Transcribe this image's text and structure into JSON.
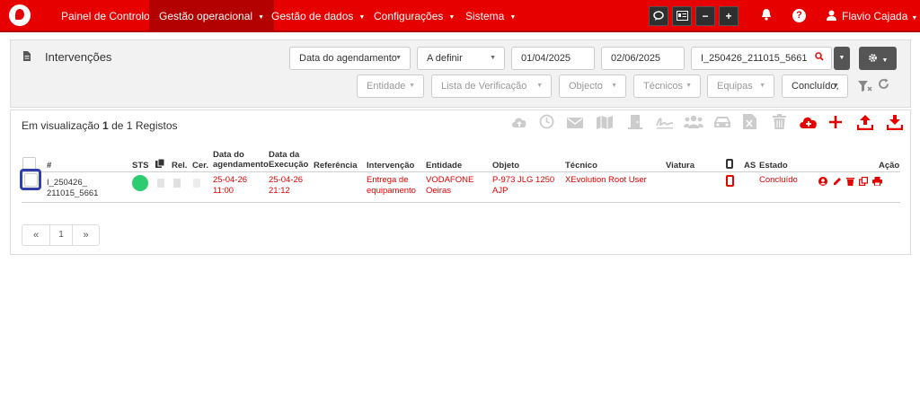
{
  "nav": {
    "items": [
      "Painel de Controlo",
      "Gestão operacional",
      "Gestão de dados",
      "Configurações",
      "Sistema"
    ],
    "toolbar": [
      "chat-icon",
      "id-card-icon",
      "−",
      "+"
    ],
    "user": "Flavio Cajada"
  },
  "header": {
    "title": "Intervenções"
  },
  "filters": {
    "date_type": "Data do agendamento",
    "period": "A definir",
    "date_from": "01/04/2025",
    "date_to": "02/06/2025",
    "search": "I_250426_211015_5661",
    "entidade": "Entidade",
    "lista": "Lista de Verificação",
    "objecto": "Objecto",
    "tecnicos": "Técnicos",
    "equipas": "Equipas",
    "estado": "Concluído,"
  },
  "results": {
    "prefix": "Em visualização",
    "shown": "1",
    "of": "de",
    "total": "1",
    "suffix": "Registos"
  },
  "table": {
    "headers": {
      "id": "#",
      "sts": "STS",
      "rel": "Rel.",
      "cer": "Cer.",
      "data_ag_1": "Data do",
      "data_ag_2": "agendamento",
      "data_ex_1": "Data da",
      "data_ex_2": "Execução",
      "referencia": "Referência",
      "intervencao": "Intervenção",
      "entidade": "Entidade",
      "objeto": "Objeto",
      "tecnico": "Técnico",
      "viatura": "Viatura",
      "as": "AS",
      "estado": "Estado",
      "acao": "Ação"
    },
    "rows": [
      {
        "id_1": "I_250426_",
        "id_2": "211015_5661",
        "ag_1": "25-04-26",
        "ag_2": "11:00",
        "ex_1": "25-04-26",
        "ex_2": "21:12",
        "int_1": "Entrega de",
        "int_2": "equipamento",
        "ent_1": "VODAFONE",
        "ent_2": "Oeiras",
        "obj_1": "P-973 JLG 1250",
        "obj_2": "AJP",
        "tecnico": "XEvolution Root User",
        "estado": "Concluído"
      }
    ]
  },
  "pager": {
    "first": "«",
    "page": "1",
    "last": "»"
  },
  "colors": {
    "brand": "#e60000",
    "brand_dark": "#b30000",
    "status_ok": "#2ecc71",
    "focus": "#3040a8"
  }
}
